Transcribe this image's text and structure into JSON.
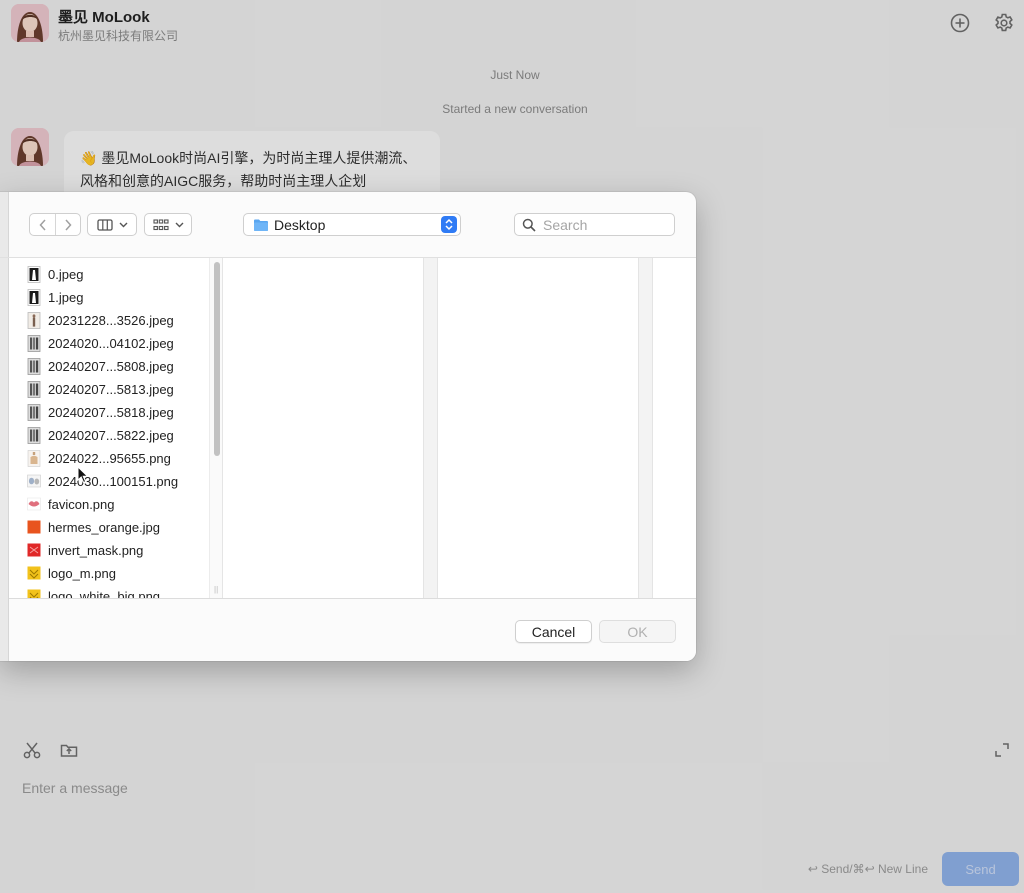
{
  "app": {
    "title": "墨见 MoLook",
    "subtitle": "杭州墨见科技有限公司",
    "new_chat_icon": "plus-circle-icon",
    "settings_icon": "gear-icon"
  },
  "conversation": {
    "timestamp": "Just Now",
    "system_note": "Started a new conversation",
    "assistant_message": "👋 墨见MoLook时尚AI引擎，为时尚主理人提供潮流、风格和创意的AIGC服务，帮助时尚主理人企划"
  },
  "composer": {
    "placeholder": "Enter a message",
    "hint": "↩ Send/⌘↩ New Line",
    "send_label": "Send",
    "tools": [
      "scissors-icon",
      "folder-upload-icon"
    ],
    "expand_icon": "expand-icon"
  },
  "file_dialog": {
    "location": "Desktop",
    "search_placeholder": "Search",
    "cancel_label": "Cancel",
    "ok_label": "OK",
    "files": [
      {
        "name": "0.jpeg",
        "thumb": "dark-figure"
      },
      {
        "name": "1.jpeg",
        "thumb": "dark-figure"
      },
      {
        "name": "20231228...3526.jpeg",
        "thumb": "figure"
      },
      {
        "name": "2024020...04102.jpeg",
        "thumb": "figure-group"
      },
      {
        "name": "20240207...5808.jpeg",
        "thumb": "figure-group"
      },
      {
        "name": "20240207...5813.jpeg",
        "thumb": "figure-group"
      },
      {
        "name": "20240207...5818.jpeg",
        "thumb": "figure-group"
      },
      {
        "name": "20240207...5822.jpeg",
        "thumb": "figure-group"
      },
      {
        "name": "2024022...95655.png",
        "thumb": "bottle"
      },
      {
        "name": "2024030...100151.png",
        "thumb": "items"
      },
      {
        "name": "favicon.png",
        "thumb": "lips"
      },
      {
        "name": "hermes_orange.jpg",
        "thumb": "orange-square"
      },
      {
        "name": "invert_mask.png",
        "thumb": "red-square"
      },
      {
        "name": "logo_m.png",
        "thumb": "yellow-logo"
      },
      {
        "name": "logo_white_big.png",
        "thumb": "yellow-logo"
      }
    ]
  },
  "colors": {
    "accent": "#2f7bf5",
    "send_button": "#8fb1e8"
  }
}
